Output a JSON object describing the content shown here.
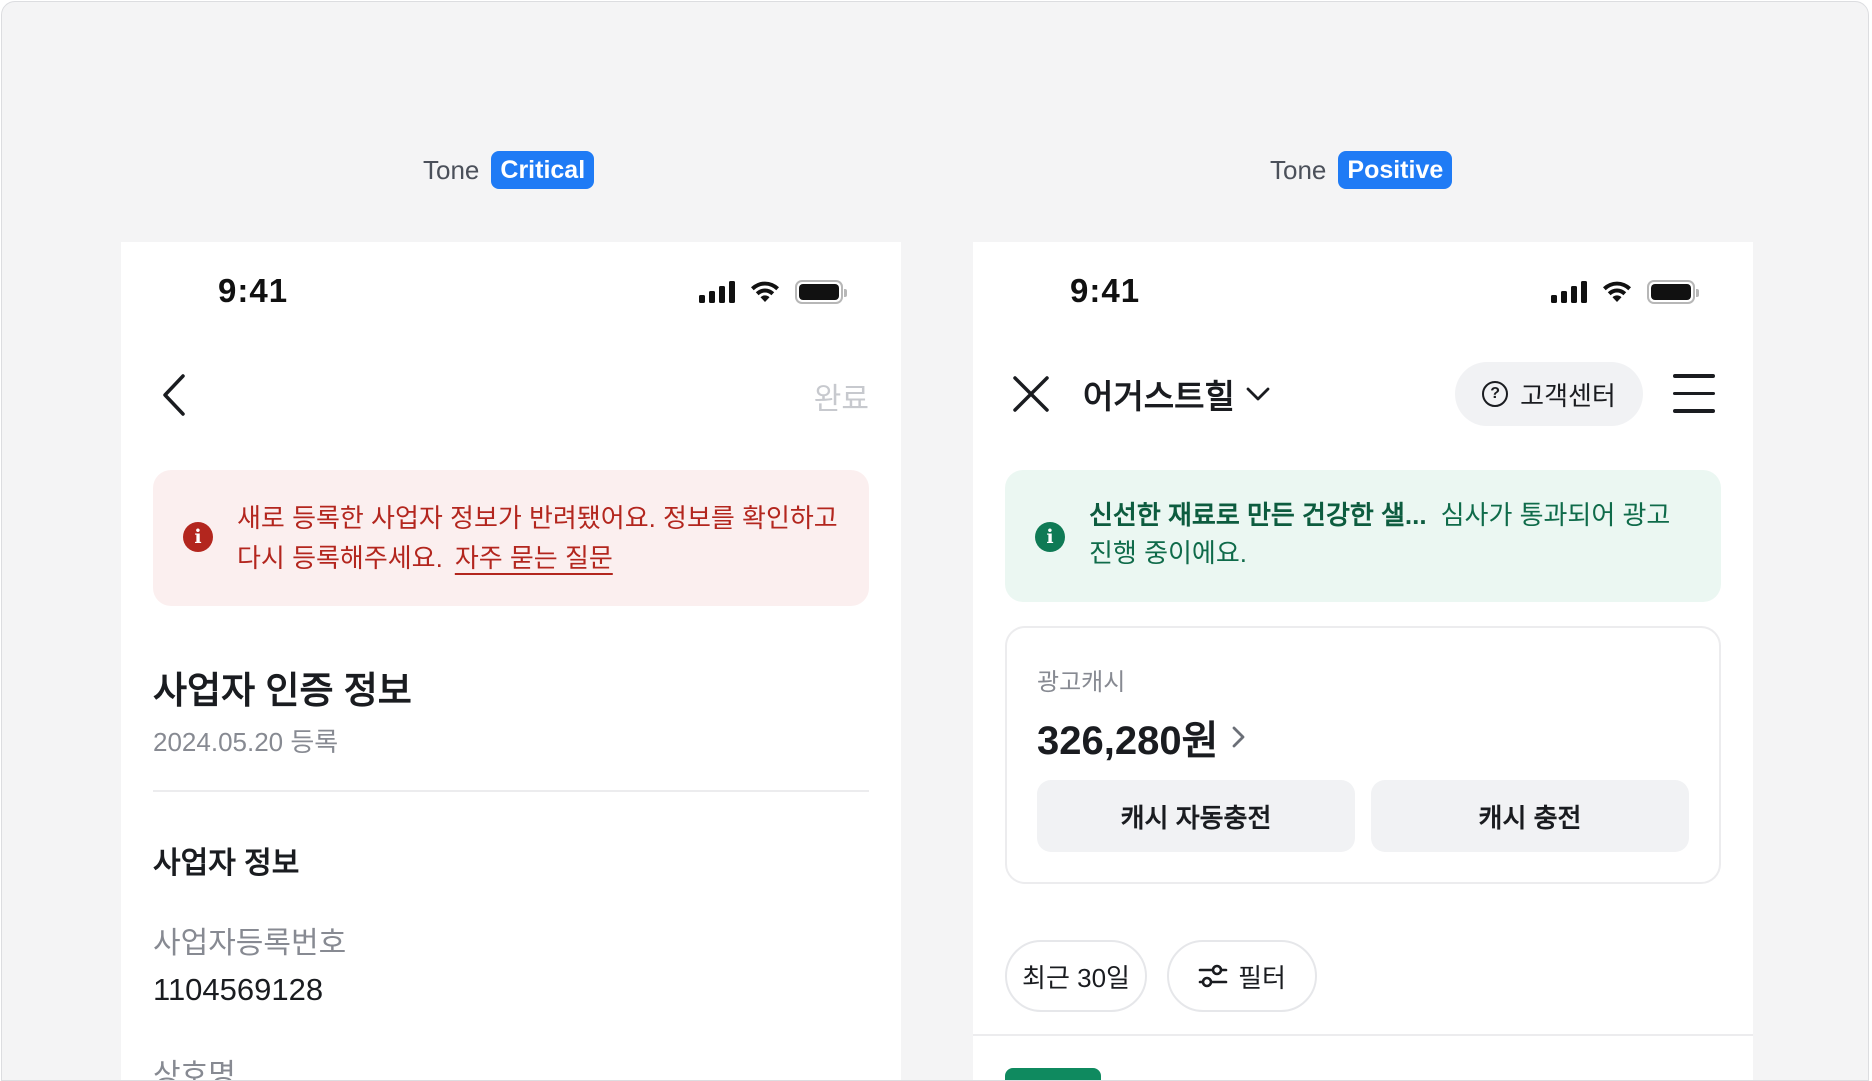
{
  "left_panel": {
    "tone_label": "Tone",
    "tone_badge": "Critical",
    "status": {
      "time": "9:41"
    },
    "nav": {
      "done_label": "완료"
    },
    "alert": {
      "message": "새로 등록한 사업자 정보가 반려됐어요. 정보를 확인하고 다시 등록해주세요.",
      "link_label": "자주 묻는 질문",
      "color": "#b3261e",
      "background": "#fbefef"
    },
    "section": {
      "title": "사업자 인증 정보",
      "date": "2024.05.20 등록"
    },
    "business_info": {
      "title": "사업자 정보",
      "fields": [
        {
          "label": "사업자등록번호",
          "value": "1104569128"
        },
        {
          "label": "상호명",
          "value": ""
        }
      ]
    }
  },
  "right_panel": {
    "tone_label": "Tone",
    "tone_badge": "Positive",
    "status": {
      "time": "9:41"
    },
    "nav": {
      "brand": "어거스트힐",
      "help_label": "고객센터"
    },
    "alert": {
      "title": "신선한 재료로 만든 건강한 샐...",
      "message": "심사가 통과되어 광고 진행 중이에요.",
      "color": "#0f6b4a",
      "background": "#ebf7f2"
    },
    "cash": {
      "label": "광고캐시",
      "amount": "326,280원",
      "auto_charge_label": "캐시 자동충전",
      "charge_label": "캐시 충전"
    },
    "filters": {
      "period_label": "최근 30일",
      "filter_label": "필터"
    }
  },
  "colors": {
    "accent": "#1f7bf5",
    "canvas": "#f4f4f5"
  }
}
